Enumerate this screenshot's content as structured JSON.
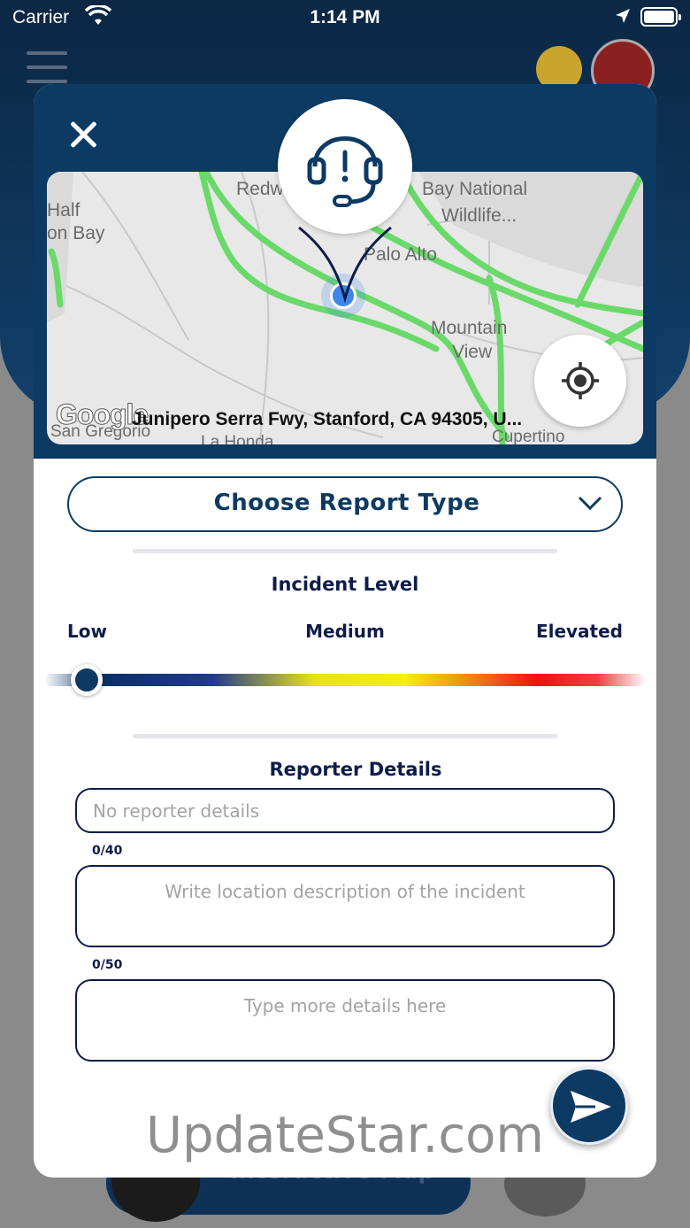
{
  "status_bar": {
    "carrier": "Carrier",
    "time": "1:14 PM"
  },
  "background": {
    "bottom_button_label": "Interactive Map"
  },
  "map": {
    "places": [
      "Redw",
      "Bay National",
      "Wildlife...",
      "Half",
      "on Bay",
      "Palo Alto",
      "Mountain",
      "View",
      "San Gregorio",
      "La Honda",
      "Cupertino"
    ],
    "address": "Junipero Serra Fwy, Stanford, CA 94305, U...",
    "provider": "Google"
  },
  "report_type": {
    "label": "Choose Report Type"
  },
  "incident_level": {
    "title": "Incident Level",
    "low": "Low",
    "medium": "Medium",
    "elevated": "Elevated",
    "value": 0.07
  },
  "reporter": {
    "title": "Reporter Details",
    "reporter_placeholder": "No reporter details",
    "location_counter": "0/40",
    "location_placeholder": "Write location description of the incident",
    "details_counter": "0/50",
    "details_placeholder": "Type more details here"
  },
  "watermark": "UpdateStar.com",
  "colors": {
    "primary": "#0c3a63",
    "road": "#6ad96a",
    "pin": "#3e86ea"
  }
}
